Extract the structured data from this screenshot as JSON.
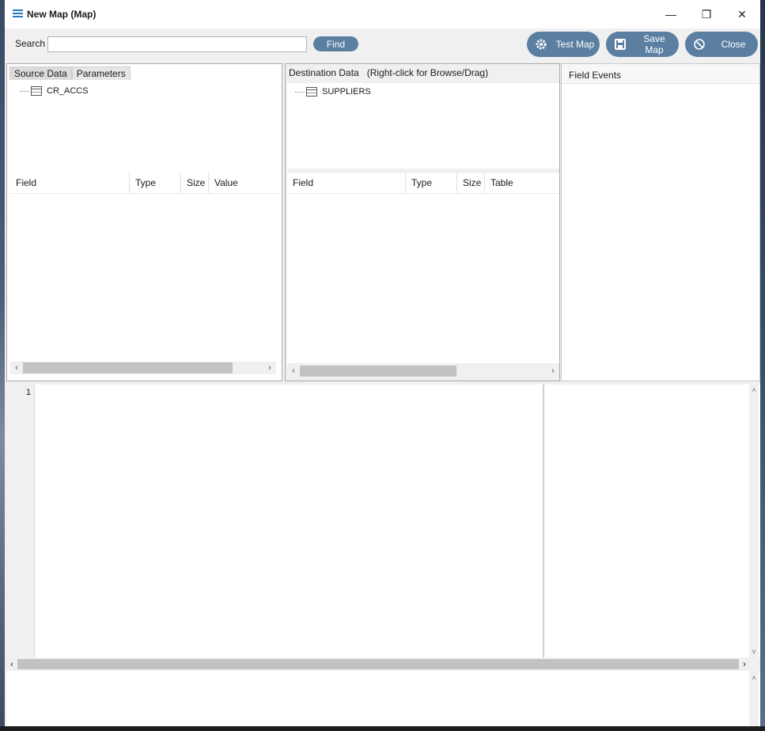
{
  "window": {
    "title": "New Map (Map)",
    "minimize": "—",
    "restore": "❐",
    "close": "✕"
  },
  "toolbar": {
    "search_label": "Search",
    "search_value": "",
    "find_label": "Find",
    "test_map_label": "Test Map",
    "save_map_label": "Save Map",
    "close_label": "Close"
  },
  "source": {
    "tabs": [
      "Source Data",
      "Parameters"
    ],
    "tree_item": "CR_ACCS",
    "columns": [
      "Field",
      "Type",
      "Size",
      "Value"
    ]
  },
  "destination": {
    "header": "Destination Data   (Right-click for Browse/Drag)",
    "tree_item": "SUPPLIERS",
    "columns": [
      "Field",
      "Type",
      "Size",
      "Table"
    ]
  },
  "field_events": {
    "header": "Field Events"
  },
  "editor": {
    "line_numbers": [
      "1"
    ]
  },
  "colors": {
    "accent_button": "#5a7fa0",
    "title_icon": "#2a76c6"
  }
}
